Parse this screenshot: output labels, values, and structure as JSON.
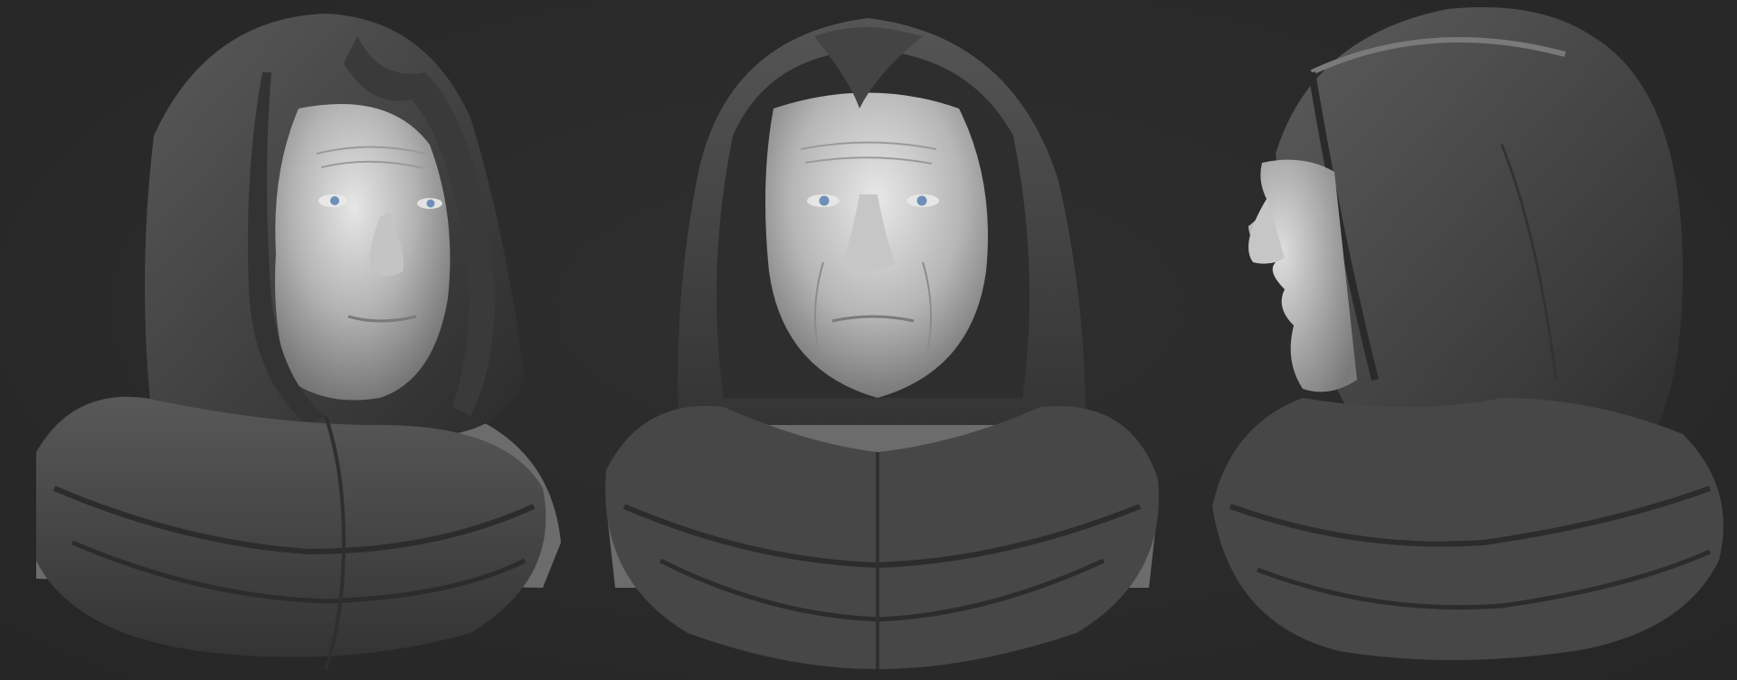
{
  "scene": {
    "background_color": "#2a2a2a",
    "views": [
      {
        "name": "three-quarter-view",
        "subject": "hooded-elderly-man-bust"
      },
      {
        "name": "front-view",
        "subject": "hooded-elderly-man-bust"
      },
      {
        "name": "profile-view",
        "subject": "hooded-elderly-man-bust"
      }
    ],
    "colors": {
      "cloth": "#4a4a4a",
      "cloth_dark": "#2e2e2e",
      "cloth_light": "#6a6a6a",
      "skin": "#b8b8b8",
      "skin_light": "#dcdcdc",
      "eye_iris": "#6f8fb8"
    }
  }
}
